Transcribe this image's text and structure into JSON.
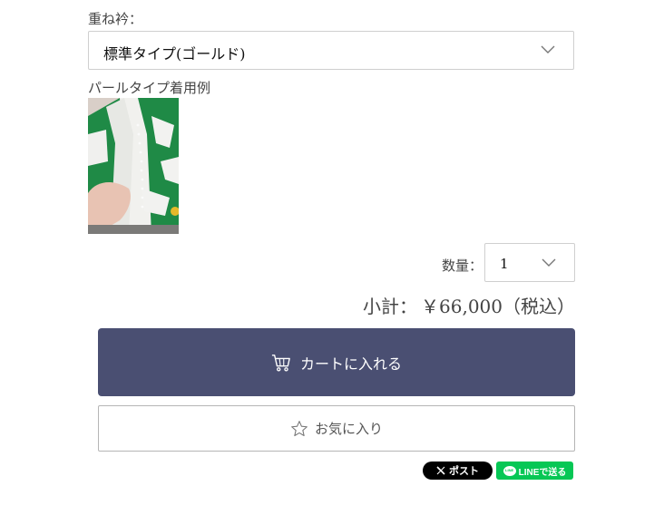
{
  "option": {
    "label": "重ね衿：",
    "selected": "標準タイプ(ゴールド)",
    "icon": "chevron-down-icon"
  },
  "example": {
    "label": "パールタイプ着用例",
    "image_alt": "パールタイプ着用例"
  },
  "quantity": {
    "label": "数量：",
    "value": "1",
    "icon": "chevron-down-icon"
  },
  "subtotal": {
    "label": "小計：",
    "value": "￥66,000（税込）"
  },
  "cart_button": {
    "label": "カートに入れる",
    "icon": "cart-icon",
    "color": "#4a4f72"
  },
  "favorite_button": {
    "label": "お気に入り",
    "icon": "star-icon"
  },
  "share": {
    "x_label": "ポスト",
    "line_label": "LINEで送る",
    "line_color": "#06c755"
  }
}
